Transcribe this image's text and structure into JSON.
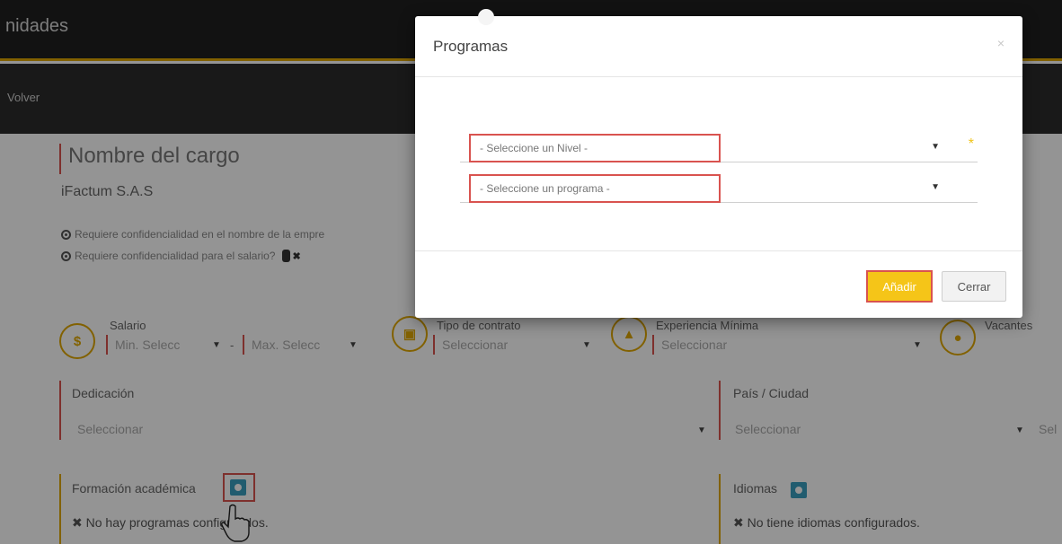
{
  "app": {
    "title": "nidades",
    "back_label": "Volver"
  },
  "job": {
    "title": "Nombre del cargo",
    "company": "iFactum S.A.S",
    "confidential_name": "Requiere confidencialidad en el nombre de la empre",
    "confidential_salary": "Requiere confidencialidad para el salario?"
  },
  "salary": {
    "label": "Salario",
    "icon": "$",
    "min": "Min. Selecc",
    "max": "Max. Selecc",
    "separator": "-"
  },
  "contract": {
    "label": "Tipo de contrato",
    "value": "Seleccionar"
  },
  "experience": {
    "label": "Experiencia Mínima",
    "value": "Seleccionar"
  },
  "vacancies": {
    "label": "Vacantes"
  },
  "dedication": {
    "label": "Dedicación",
    "value": "Seleccionar"
  },
  "location": {
    "label": "País / Ciudad",
    "value": "Seleccionar",
    "value2": "Sel"
  },
  "education": {
    "label": "Formación académica",
    "empty": "No hay programas configurados."
  },
  "languages": {
    "label": "Idiomas",
    "empty": "No tiene idiomas configurados."
  },
  "modal": {
    "title": "Programas",
    "close_glyph": "×",
    "level_select": "- Seleccione un Nivel -",
    "program_select": "- Seleccione un programa -",
    "required_mark": "*",
    "add_button": "Añadir",
    "close_button": "Cerrar"
  },
  "colors": {
    "accent": "#f5c518",
    "error": "#d9534f",
    "info": "#3a9fbf"
  }
}
